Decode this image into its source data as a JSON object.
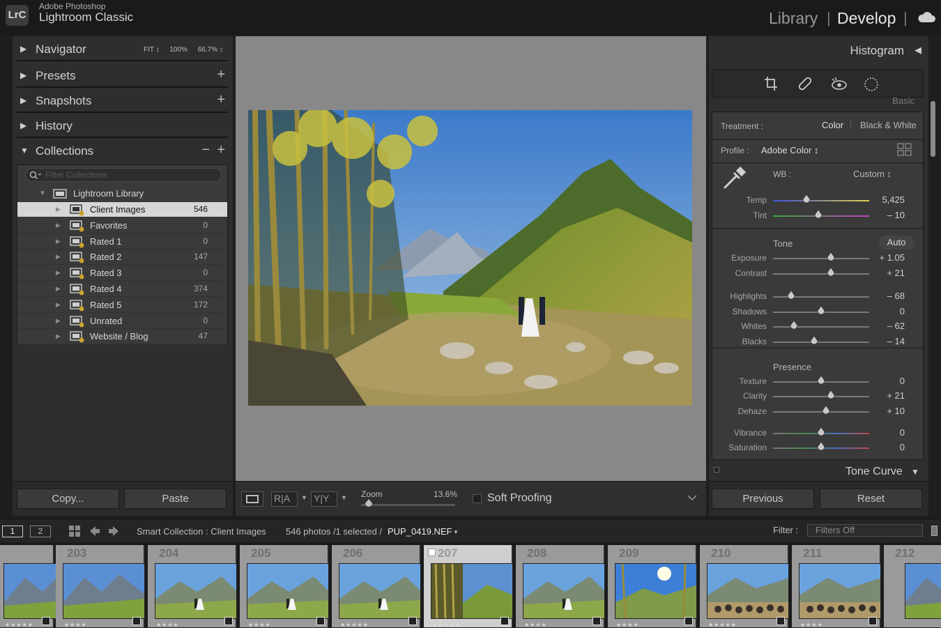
{
  "app": {
    "vendor": "Adobe Photoshop",
    "name": "Lightroom Classic",
    "logo": "LrC"
  },
  "modules": {
    "library": "Library",
    "develop": "Develop",
    "separator": "|"
  },
  "left_panel": {
    "navigator": {
      "title": "Navigator",
      "options": [
        "FIT ↕",
        "100%",
        "66.7% ↕"
      ]
    },
    "presets": {
      "title": "Presets",
      "add": "+"
    },
    "snapshots": {
      "title": "Snapshots",
      "add": "+"
    },
    "history": {
      "title": "History"
    },
    "collections": {
      "title": "Collections",
      "minus": "−",
      "add": "+",
      "filter_placeholder": "Filter Collections",
      "library_label": "Lightroom Library",
      "items": [
        {
          "label": "Client Images",
          "count": "546"
        },
        {
          "label": "Favorites",
          "count": "0"
        },
        {
          "label": "Rated 1",
          "count": "0"
        },
        {
          "label": "Rated 2",
          "count": "147"
        },
        {
          "label": "Rated 3",
          "count": "0"
        },
        {
          "label": "Rated 4",
          "count": "374"
        },
        {
          "label": "Rated 5",
          "count": "172"
        },
        {
          "label": "Unrated",
          "count": "0"
        },
        {
          "label": "Website / Blog",
          "count": "47"
        }
      ]
    },
    "copy_label": "Copy...",
    "paste_label": "Paste"
  },
  "toolbar": {
    "zoom_label": "Zoom",
    "zoom_value": "13.6%",
    "zoom_fraction": 0.08,
    "soft_proofing": "Soft Proofing"
  },
  "right_panel": {
    "histogram_title": "Histogram",
    "basic_peek": "Basic",
    "treatment_label": "Treatment :",
    "treatment_color": "Color",
    "treatment_bw": "Black & White",
    "profile_label": "Profile :",
    "profile_value": "Adobe Color ↕",
    "wb_label": "WB :",
    "wb_value": "Custom ↕",
    "tone_label": "Tone",
    "auto_label": "Auto",
    "presence_label": "Presence",
    "tone_curve": "Tone Curve",
    "previous": "Previous",
    "reset": "Reset",
    "sliders": {
      "temp": {
        "label": "Temp",
        "value": "5,425",
        "pos": 0.35
      },
      "tint": {
        "label": "Tint",
        "value": "– 10",
        "pos": 0.47
      },
      "exposure": {
        "label": "Exposure",
        "value": "+ 1.05",
        "pos": 0.6
      },
      "contrast": {
        "label": "Contrast",
        "value": "+ 21",
        "pos": 0.6
      },
      "highlights": {
        "label": "Highlights",
        "value": "– 68",
        "pos": 0.19
      },
      "shadows": {
        "label": "Shadows",
        "value": "0",
        "pos": 0.5
      },
      "whites": {
        "label": "Whites",
        "value": "– 62",
        "pos": 0.22
      },
      "blacks": {
        "label": "Blacks",
        "value": "– 14",
        "pos": 0.43
      },
      "texture": {
        "label": "Texture",
        "value": "0",
        "pos": 0.5
      },
      "clarity": {
        "label": "Clarity",
        "value": "+ 21",
        "pos": 0.6
      },
      "dehaze": {
        "label": "Dehaze",
        "value": "+ 10",
        "pos": 0.55
      },
      "vibrance": {
        "label": "Vibrance",
        "value": "0",
        "pos": 0.5
      },
      "saturation": {
        "label": "Saturation",
        "value": "0",
        "pos": 0.5
      }
    }
  },
  "filmstrip_bar": {
    "page1": "1",
    "page2": "2",
    "source": "Smart Collection : Client Images",
    "count": "546 photos /1 selected /",
    "filename": "PUP_0419.NEF",
    "filter_label": "Filter :",
    "filter_value": "Filters Off"
  },
  "filmstrip": [
    {
      "num": "",
      "stars": "★★★★★",
      "scene": "mountain"
    },
    {
      "num": "203",
      "stars": "★★★★",
      "scene": "mountain"
    },
    {
      "num": "204",
      "stars": "★★★★",
      "scene": "couple"
    },
    {
      "num": "205",
      "stars": "★★★★",
      "scene": "couple"
    },
    {
      "num": "206",
      "stars": "★★★★★",
      "scene": "couple"
    },
    {
      "num": "207",
      "stars": "★★★★★",
      "scene": "aspen"
    },
    {
      "num": "208",
      "stars": "★★★★",
      "scene": "couple"
    },
    {
      "num": "209",
      "stars": "★★★★",
      "scene": "sun"
    },
    {
      "num": "210",
      "stars": "★★★★★",
      "scene": "guests"
    },
    {
      "num": "211",
      "stars": "★★★★",
      "scene": "guests"
    },
    {
      "num": "212",
      "stars": "",
      "scene": "mountain"
    }
  ],
  "colors": {
    "accent": "#d6d6d6",
    "panel": "#2e2e2e",
    "canvas": "#888888"
  }
}
